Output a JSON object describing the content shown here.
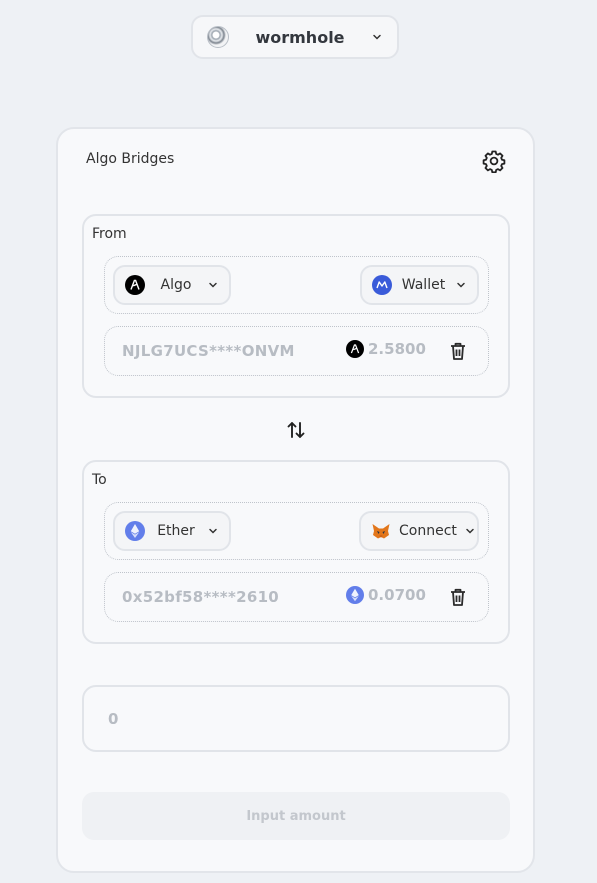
{
  "bridge": {
    "name": "wormhole",
    "icon": "wormhole-logo"
  },
  "card": {
    "title": "Algo Bridges",
    "settings_icon": "gear-icon"
  },
  "from": {
    "label": "From",
    "token": {
      "name": "Algo",
      "icon": "algorand-logo",
      "color": "#000000"
    },
    "wallet": {
      "name": "Wallet",
      "icon": "walletconnect-logo",
      "color": "#3a5bd9"
    },
    "address": "NJLG7UCS****ONVM",
    "balance": "2.5800"
  },
  "swap_icon": "swap-vertical-icon",
  "to": {
    "label": "To",
    "token": {
      "name": "Ether",
      "icon": "ethereum-logo",
      "color": "#627eea"
    },
    "wallet": {
      "name": "Connect",
      "icon": "metamask-logo",
      "color": "#e2761b"
    },
    "address": "0x52bf58****2610",
    "balance": "0.0700"
  },
  "amount": {
    "value": "0"
  },
  "submit": {
    "label": "Input amount"
  }
}
